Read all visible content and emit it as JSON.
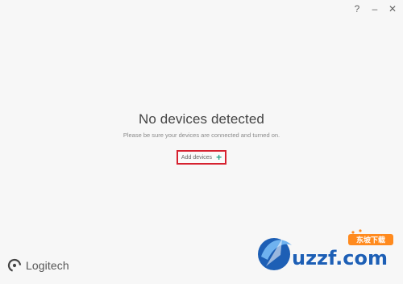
{
  "window": {
    "controls": {
      "help": "?",
      "minimize": "–",
      "close": "✕"
    }
  },
  "main": {
    "heading": "No devices detected",
    "subtext": "Please be sure your devices are connected and turned on.",
    "add_devices_label": "Add devices",
    "add_icon": "+"
  },
  "footer": {
    "brand_name": "Logitech"
  },
  "watermark": {
    "site": "uzzf.com",
    "brand_cn": "东坡下载"
  }
}
